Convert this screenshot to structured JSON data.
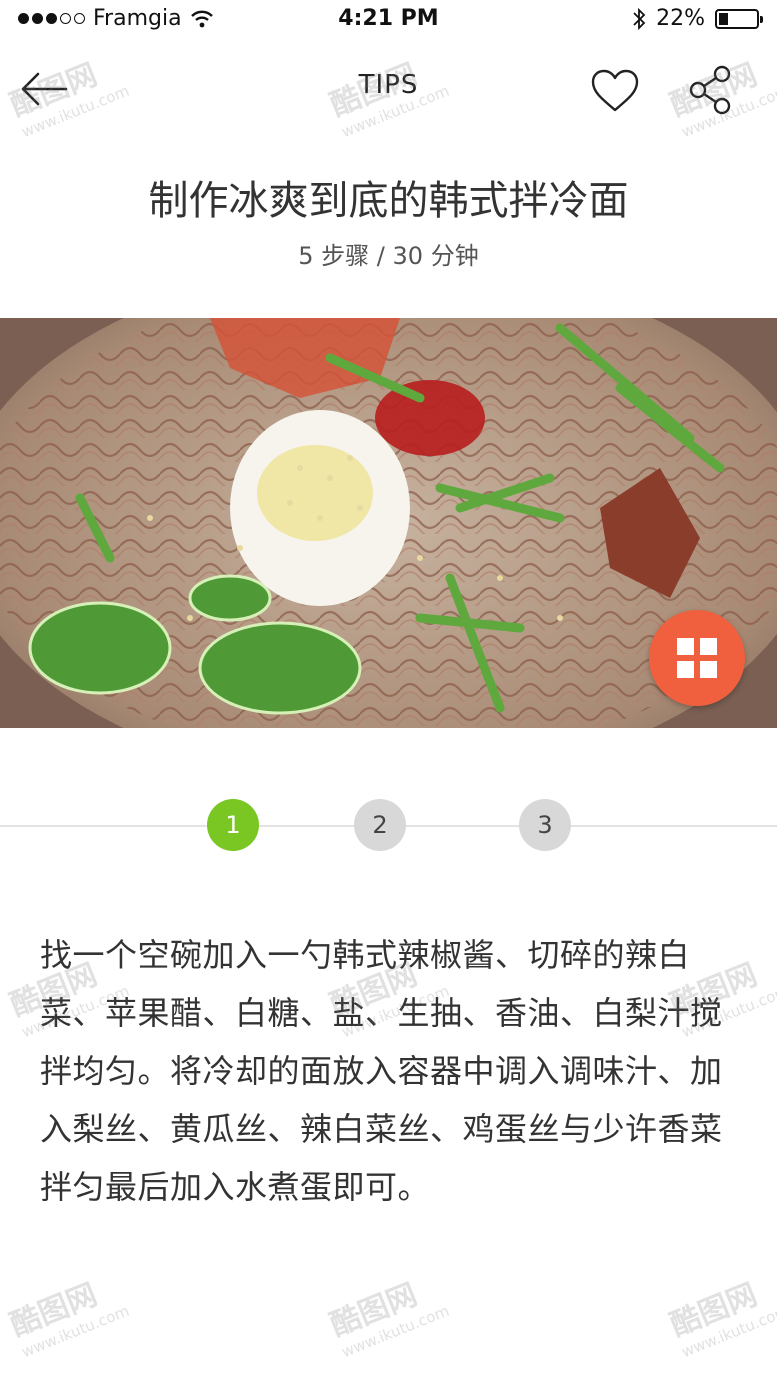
{
  "status_bar": {
    "carrier": "Framgia",
    "time": "4:21 PM",
    "battery": "22%",
    "icons": [
      "signal-dots",
      "wifi-icon",
      "bluetooth-icon",
      "battery-icon"
    ]
  },
  "nav": {
    "title": "TIPS",
    "icons": [
      "back-arrow-icon",
      "heart-icon",
      "share-icon"
    ]
  },
  "recipe": {
    "title": "制作冰爽到底的韩式拌冷面",
    "meta": "5 步骤 / 30 分钟"
  },
  "steps": {
    "items": [
      "1",
      "2",
      "3"
    ],
    "active": "1",
    "text": "找一个空碗加入一勺韩式辣椒酱、切碎的辣白菜、苹果醋、白糖、盐、生抽、香油、白梨汁搅拌均匀。将冷却的面放入容器中调入调味汁、加入梨丝、黄瓜丝、辣白菜丝、鸡蛋丝与少许香菜拌匀最后加入水煮蛋即可。"
  },
  "watermark": {
    "brand": "酷图网",
    "url": "www.ikutu.com"
  },
  "colors": {
    "accent_green": "#7ac724",
    "fab_orange": "#f0603f",
    "step_inactive": "#d8d8d8"
  }
}
